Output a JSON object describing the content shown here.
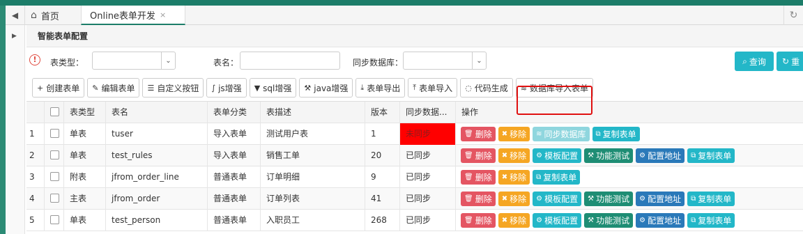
{
  "tabs": {
    "home": "首页",
    "active": "Online表单开发",
    "close": "×"
  },
  "panel_title": "智能表单配置",
  "search": {
    "type_label": "表类型：",
    "name_label": "表名：",
    "sync_db_label": "同步数据库：",
    "query_button": "查询",
    "reset_button": "重"
  },
  "toolbar": [
    {
      "label": "创建表单",
      "icon": "plus-icon"
    },
    {
      "label": "编辑表单",
      "icon": "edit-icon"
    },
    {
      "label": "自定义按钮",
      "icon": "list-icon"
    },
    {
      "label": "js增强",
      "icon": "js-icon"
    },
    {
      "label": "sql增强",
      "icon": "filter-icon"
    },
    {
      "label": "java增强",
      "icon": "wrench-icon"
    },
    {
      "label": "表单导出",
      "icon": "download-icon"
    },
    {
      "label": "表单导入",
      "icon": "upload-icon"
    },
    {
      "label": "代码生成",
      "icon": "spinner-icon"
    },
    {
      "label": "数据库导入表单",
      "icon": "database-icon"
    }
  ],
  "columns": {
    "type": "表类型",
    "name": "表名",
    "category": "表单分类",
    "desc": "表描述",
    "version": "版本",
    "sync": "同步数据...",
    "ops": "操作"
  },
  "rows": [
    {
      "num": "1",
      "type": "单表",
      "name": "tuser",
      "category": "导入表单",
      "desc": "测试用户表",
      "version": "1",
      "sync": "未同步"
    },
    {
      "num": "2",
      "type": "单表",
      "name": "test_rules",
      "category": "导入表单",
      "desc": "销售工单",
      "version": "20",
      "sync": "已同步"
    },
    {
      "num": "3",
      "type": "附表",
      "name": "jfrom_order_line",
      "category": "普通表单",
      "desc": "订单明细",
      "version": "9",
      "sync": "已同步"
    },
    {
      "num": "4",
      "type": "主表",
      "name": "jfrom_order",
      "category": "普通表单",
      "desc": "订单列表",
      "version": "41",
      "sync": "已同步"
    },
    {
      "num": "5",
      "type": "单表",
      "name": "test_person",
      "category": "普通表单",
      "desc": "入职员工",
      "version": "268",
      "sync": "已同步"
    }
  ],
  "ops_labels": {
    "delete": "删除",
    "remove": "移除",
    "sync_db": "同步数据库",
    "copy": "复制表单",
    "template": "模板配置",
    "test": "功能测试",
    "config_url": "配置地址"
  },
  "colors": {
    "brand_green": "#1c7d69",
    "teal": "#23b7c8",
    "red": "#e45562",
    "orange": "#f5a623",
    "blue": "#2a79b9",
    "unsynced_bg": "#ff0000"
  }
}
